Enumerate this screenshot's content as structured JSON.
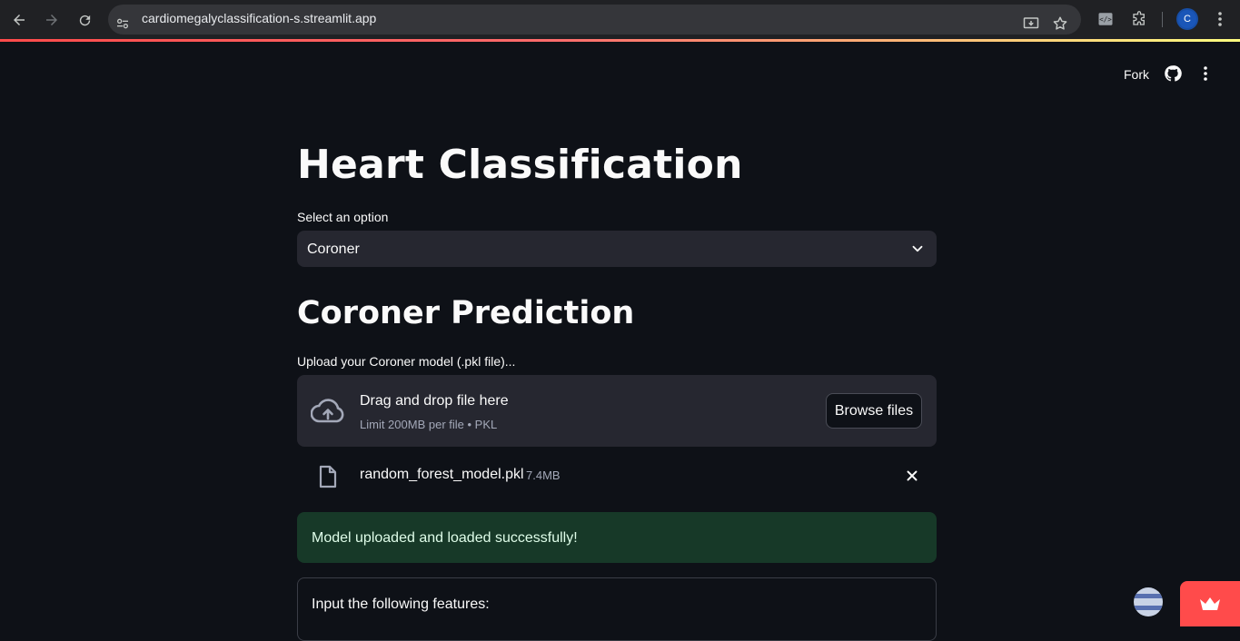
{
  "browser": {
    "url": "cardiomegalyclassification-s.streamlit.app",
    "profile_initial": "C",
    "icons": [
      "back-icon",
      "forward-icon",
      "reload-icon",
      "site-settings-icon",
      "install-app-icon",
      "bookmark-star-icon",
      "devtools-extension-icon",
      "extensions-puzzle-icon",
      "profile-avatar",
      "chrome-menu-icon"
    ]
  },
  "header": {
    "fork_label": "Fork",
    "icons": [
      "github-icon",
      "more-vert-icon"
    ]
  },
  "main": {
    "title": "Heart Classification",
    "select": {
      "label": "Select an option",
      "value": "Coroner"
    },
    "section_title": "Coroner Prediction",
    "uploader": {
      "label": "Upload your Coroner model (.pkl file)...",
      "drop_title": "Drag and drop file here",
      "drop_hint": "Limit 200MB per file • PKL",
      "browse_label": "Browse files"
    },
    "uploaded_file": {
      "name": "random_forest_model.pkl",
      "size": "7.4MB"
    },
    "success_message": "Model uploaded and loaded successfully!",
    "form_heading": "Input the following features:"
  },
  "colors": {
    "background": "#0e1117",
    "widget_bg": "#262730",
    "success_bg": "#173928",
    "accent": "#ff4b4b"
  }
}
